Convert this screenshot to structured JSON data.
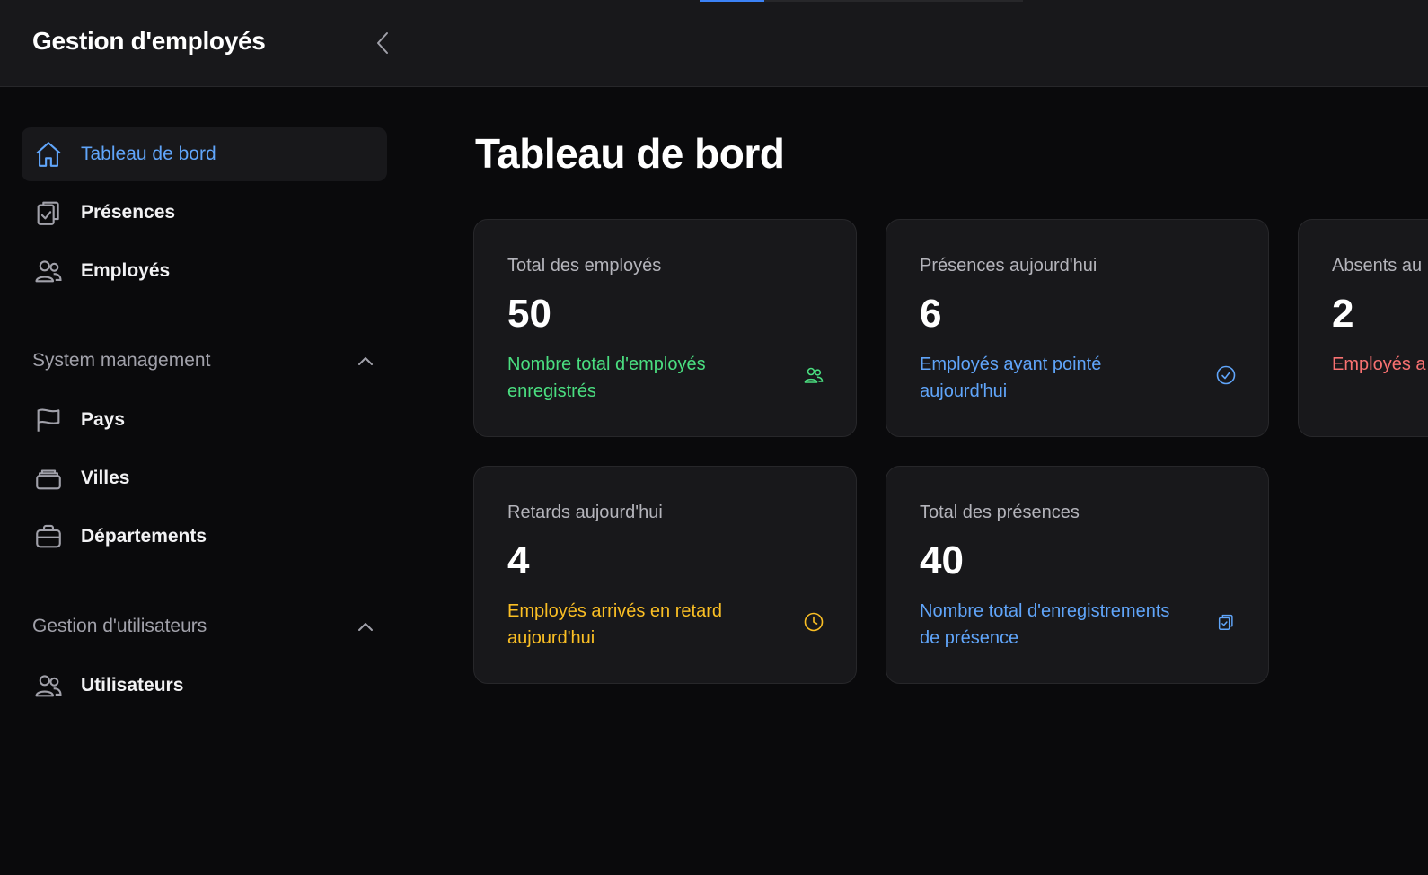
{
  "app": {
    "title": "Gestion d'employés"
  },
  "topbar": {
    "progress_percent": 20
  },
  "sidebar": {
    "items": [
      {
        "label": "Tableau de bord"
      },
      {
        "label": "Présences"
      },
      {
        "label": "Employés"
      }
    ],
    "groups": [
      {
        "title": "System management",
        "items": [
          {
            "label": "Pays"
          },
          {
            "label": "Villes"
          },
          {
            "label": "Départements"
          }
        ]
      },
      {
        "title": "Gestion d'utilisateurs",
        "items": [
          {
            "label": "Utilisateurs"
          }
        ]
      }
    ]
  },
  "main": {
    "title": "Tableau de bord",
    "cards": [
      {
        "title": "Total des employés",
        "value": "50",
        "description": "Nombre total d'employés enregistrés",
        "color": "#4ade80",
        "icon": "users-icon"
      },
      {
        "title": "Présences aujourd'hui",
        "value": "6",
        "description": "Employés ayant pointé aujourd'hui",
        "color": "#60a5fa",
        "icon": "check-circle-icon"
      },
      {
        "title": "Absents au",
        "value": "2",
        "description": "Employés a",
        "color": "#f87171",
        "icon": ""
      },
      {
        "title": "Retards aujourd'hui",
        "value": "4",
        "description": "Employés arrivés en retard aujourd'hui",
        "color": "#fbbf24",
        "icon": "clock-icon"
      },
      {
        "title": "Total des présences",
        "value": "40",
        "description": "Nombre total d'enregistrements de présence",
        "color": "#60a5fa",
        "icon": "clipboard-icon"
      }
    ]
  },
  "colors": {
    "accent": "#60a5fa",
    "background": "#0a0a0c",
    "surface": "#18181b"
  }
}
